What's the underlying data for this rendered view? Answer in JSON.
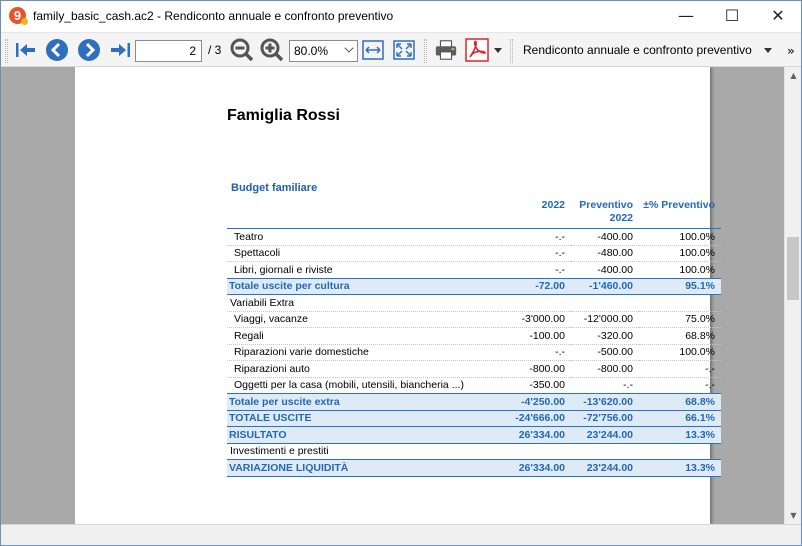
{
  "window": {
    "title": "family_basic_cash.ac2 - Rendiconto annuale e confronto preventivo",
    "app_icon_letter": "9",
    "minimize": "—",
    "maximize": "☐",
    "close": "✕"
  },
  "toolbar": {
    "page_current": "2",
    "page_total": "/ 3",
    "zoom": "80.0%",
    "report_name": "Rendiconto annuale e confronto preventivo",
    "icons": [
      "first-page-icon",
      "previous-page-icon",
      "next-page-icon",
      "last-page-icon",
      "zoom-out-icon",
      "zoom-in-icon",
      "fit-width-icon",
      "fit-page-icon",
      "print-icon",
      "pdf-icon",
      "dropdown-arrow-icon"
    ],
    "colors": {
      "nav_blue": "#2f6fbf",
      "pdf_red": "#d9262c"
    }
  },
  "report": {
    "title": "Famiglia Rossi",
    "section": "Budget familiare",
    "columns": [
      "2022",
      "Preventivo 2022",
      "±% Preventivo"
    ],
    "rows": [
      {
        "label": "Teatro",
        "kind": "item",
        "c1": "-.-",
        "c2": "-400.00",
        "c3": "100.0%"
      },
      {
        "label": "Spettacoli",
        "kind": "item",
        "c1": "-.-",
        "c2": "-480.00",
        "c3": "100.0%"
      },
      {
        "label": "Libri, giornali e riviste",
        "kind": "item",
        "c1": "-.-",
        "c2": "-400.00",
        "c3": "100.0%"
      },
      {
        "label": "Totale uscite per cultura",
        "kind": "total",
        "c1": "-72.00",
        "c2": "-1'460.00",
        "c3": "95.1%"
      },
      {
        "label": "Variabili Extra",
        "kind": "group",
        "c1": "",
        "c2": "",
        "c3": ""
      },
      {
        "label": "Viaggi, vacanze",
        "kind": "item",
        "c1": "-3'000.00",
        "c2": "-12'000.00",
        "c3": "75.0%"
      },
      {
        "label": "Regali",
        "kind": "item",
        "c1": "-100.00",
        "c2": "-320.00",
        "c3": "68.8%"
      },
      {
        "label": "Riparazioni varie domestiche",
        "kind": "item",
        "c1": "-.-",
        "c2": "-500.00",
        "c3": "100.0%"
      },
      {
        "label": "Riparazioni auto",
        "kind": "item",
        "c1": "-800.00",
        "c2": "-800.00",
        "c3": "-.-"
      },
      {
        "label": "Oggetti per la casa (mobili, utensili, biancheria ...)",
        "kind": "item",
        "c1": "-350.00",
        "c2": "-.-",
        "c3": "-.-"
      },
      {
        "label": "Totale per uscite extra",
        "kind": "total",
        "c1": "-4'250.00",
        "c2": "-13'620.00",
        "c3": "68.8%"
      },
      {
        "label": "TOTALE USCITE",
        "kind": "total",
        "c1": "-24'666.00",
        "c2": "-72'756.00",
        "c3": "66.1%"
      },
      {
        "label": "RISULTATO",
        "kind": "total",
        "c1": "26'334.00",
        "c2": "23'244.00",
        "c3": "13.3%"
      },
      {
        "label": "Investimenti e prestiti",
        "kind": "group",
        "c1": "",
        "c2": "",
        "c3": ""
      },
      {
        "label": "VARIAZIONE LIQUIDITÀ",
        "kind": "total",
        "c1": "26'334.00",
        "c2": "23'244.00",
        "c3": "13.3%"
      }
    ]
  },
  "colors": {
    "accent": "#2368b7",
    "total_bg": "#dfeaf7",
    "viewport_bg": "#a9a9a9"
  }
}
